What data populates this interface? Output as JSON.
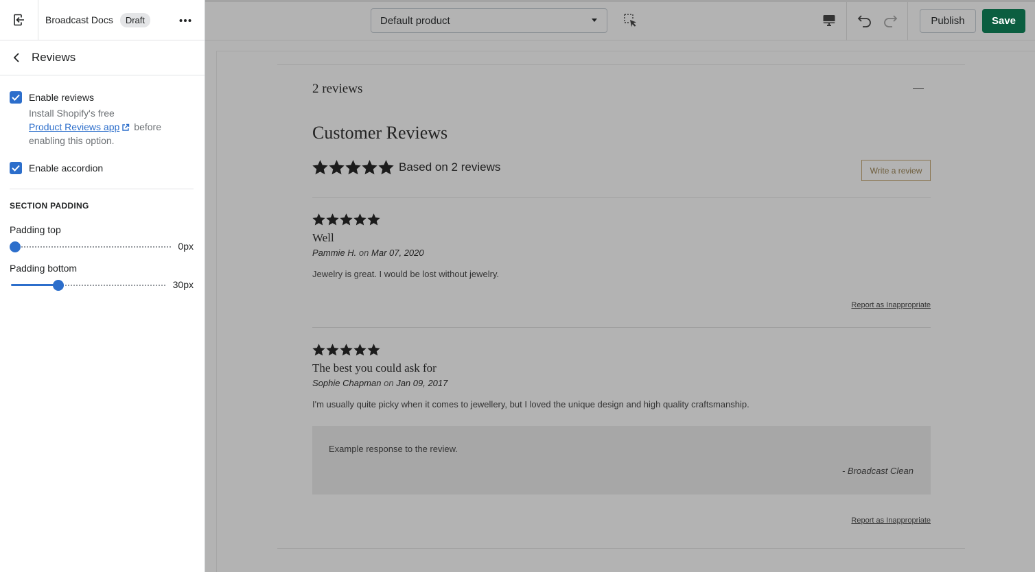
{
  "sidebar": {
    "store_name": "Broadcast Docs",
    "status_badge": "Draft",
    "section_title": "Reviews",
    "enable_reviews": {
      "label": "Enable reviews",
      "checked": true,
      "help_prefix": "Install Shopify's free",
      "help_link": "Product Reviews app",
      "help_suffix_1": "before",
      "help_suffix_2": "enabling this option."
    },
    "enable_accordion": {
      "label": "Enable accordion",
      "checked": true
    },
    "padding_heading": "SECTION PADDING",
    "padding_top": {
      "label": "Padding top",
      "value_text": "0px",
      "value": 0
    },
    "padding_bottom": {
      "label": "Padding bottom",
      "value_text": "30px",
      "value": 30
    }
  },
  "topbar": {
    "template_select": "Default product",
    "publish_label": "Publish",
    "save_label": "Save",
    "save_color": "#0b5e40"
  },
  "preview": {
    "accordion_title": "2 reviews",
    "heading": "Customer Reviews",
    "summary_rating": 5,
    "summary_text": "Based on 2 reviews",
    "write_review_label": "Write a review",
    "reviews": [
      {
        "rating": 5,
        "title": "Well",
        "author": "Pammie H.",
        "on": "on",
        "date": "Mar 07, 2020",
        "body": "Jewelry is great. I would be lost without jewelry.",
        "report_label": "Report as Inappropriate"
      },
      {
        "rating": 5,
        "title": "The best you could ask for",
        "author": "Sophie Chapman",
        "on": "on",
        "date": "Jan 09, 2017",
        "body": "I'm usually quite picky when it comes to jewellery, but I loved the unique design and high quality craftsmanship.",
        "response_text": "Example response to the review.",
        "response_author": "- Broadcast Clean",
        "report_label": "Report as Inappropriate"
      }
    ]
  }
}
